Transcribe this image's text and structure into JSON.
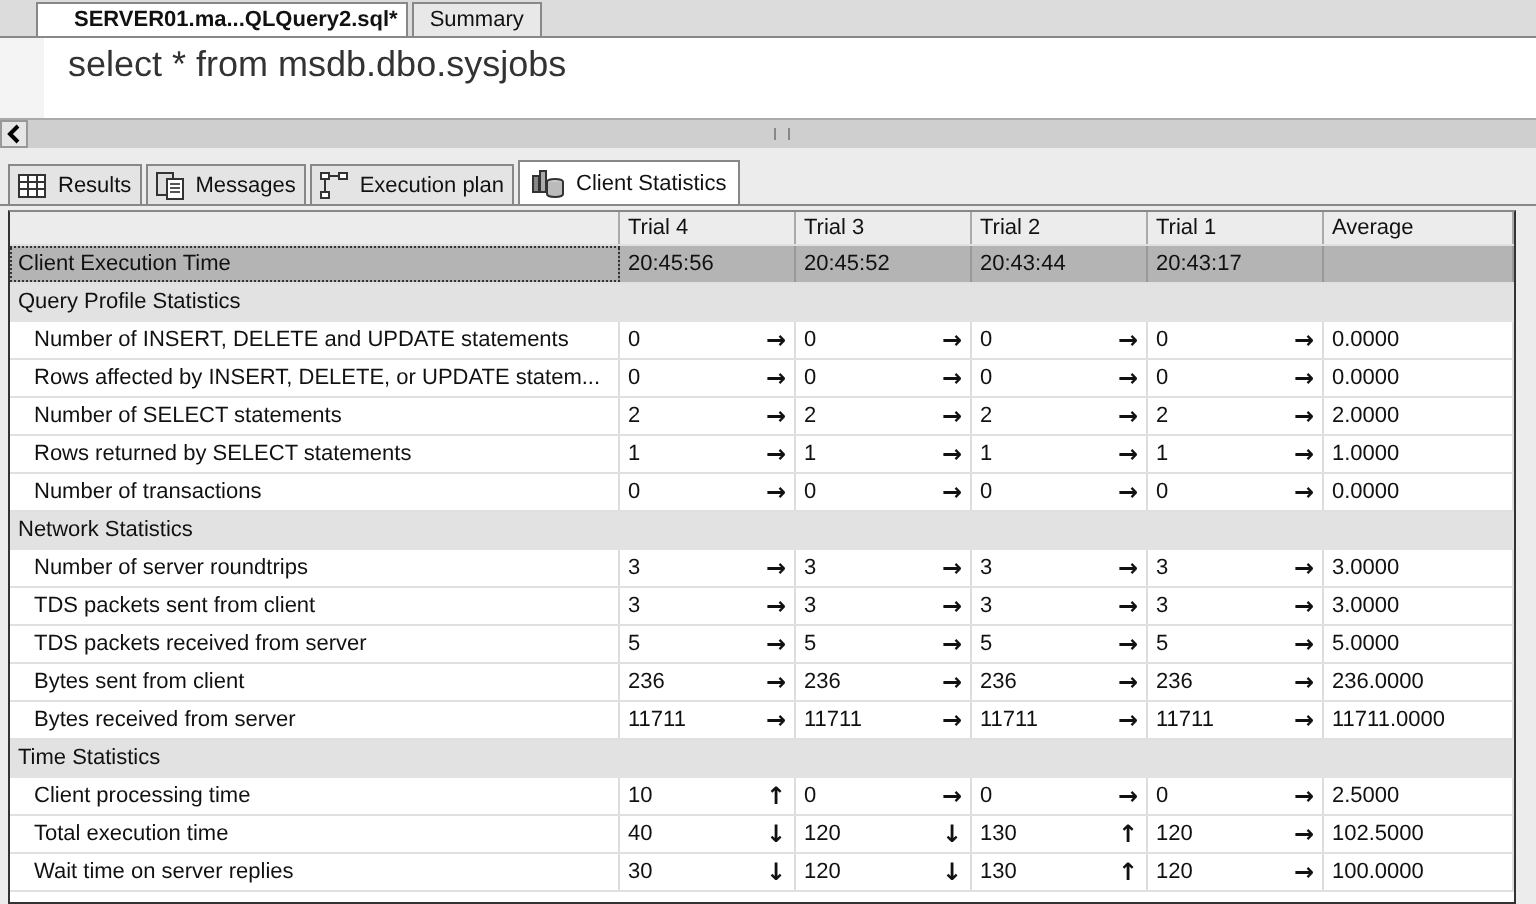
{
  "document_tabs": [
    {
      "label": "SERVER01.ma...QLQuery2.sql*",
      "selected": true
    },
    {
      "label": "Summary",
      "selected": false
    }
  ],
  "editor": {
    "text": "select * from msdb.dbo.sysjobs"
  },
  "result_tabs": [
    {
      "label": "Results",
      "kind": "grid",
      "selected": false
    },
    {
      "label": "Messages",
      "kind": "messages",
      "selected": false
    },
    {
      "label": "Execution plan",
      "kind": "plan",
      "selected": false
    },
    {
      "label": "Client Statistics",
      "kind": "stats",
      "selected": true
    }
  ],
  "grid": {
    "columns": [
      "Trial 4",
      "Trial 3",
      "Trial 2",
      "Trial 1",
      "Average"
    ],
    "execution_row": {
      "label": "Client Execution Time",
      "values": [
        "20:45:56",
        "20:45:52",
        "20:43:44",
        "20:43:17"
      ]
    },
    "sections": [
      {
        "title": "Query Profile Statistics",
        "rows": [
          {
            "label": "Number of INSERT, DELETE and UPDATE statements",
            "values": [
              {
                "text": "0",
                "arrow": "→"
              },
              {
                "text": "0",
                "arrow": "→"
              },
              {
                "text": "0",
                "arrow": "→"
              },
              {
                "text": "0",
                "arrow": "→"
              }
            ],
            "average": "0.0000"
          },
          {
            "label": "Rows affected by INSERT, DELETE, or UPDATE statem...",
            "values": [
              {
                "text": "0",
                "arrow": "→"
              },
              {
                "text": "0",
                "arrow": "→"
              },
              {
                "text": "0",
                "arrow": "→"
              },
              {
                "text": "0",
                "arrow": "→"
              }
            ],
            "average": "0.0000"
          },
          {
            "label": "Number of SELECT statements",
            "values": [
              {
                "text": "2",
                "arrow": "→"
              },
              {
                "text": "2",
                "arrow": "→"
              },
              {
                "text": "2",
                "arrow": "→"
              },
              {
                "text": "2",
                "arrow": "→"
              }
            ],
            "average": "2.0000"
          },
          {
            "label": "Rows returned by SELECT statements",
            "values": [
              {
                "text": "1",
                "arrow": "→"
              },
              {
                "text": "1",
                "arrow": "→"
              },
              {
                "text": "1",
                "arrow": "→"
              },
              {
                "text": "1",
                "arrow": "→"
              }
            ],
            "average": "1.0000"
          },
          {
            "label": "Number of transactions",
            "values": [
              {
                "text": "0",
                "arrow": "→"
              },
              {
                "text": "0",
                "arrow": "→"
              },
              {
                "text": "0",
                "arrow": "→"
              },
              {
                "text": "0",
                "arrow": "→"
              }
            ],
            "average": "0.0000"
          }
        ]
      },
      {
        "title": "Network Statistics",
        "rows": [
          {
            "label": "Number of server roundtrips",
            "values": [
              {
                "text": "3",
                "arrow": "→"
              },
              {
                "text": "3",
                "arrow": "→"
              },
              {
                "text": "3",
                "arrow": "→"
              },
              {
                "text": "3",
                "arrow": "→"
              }
            ],
            "average": "3.0000"
          },
          {
            "label": "TDS packets sent from client",
            "values": [
              {
                "text": "3",
                "arrow": "→"
              },
              {
                "text": "3",
                "arrow": "→"
              },
              {
                "text": "3",
                "arrow": "→"
              },
              {
                "text": "3",
                "arrow": "→"
              }
            ],
            "average": "3.0000"
          },
          {
            "label": "TDS packets received from server",
            "values": [
              {
                "text": "5",
                "arrow": "→"
              },
              {
                "text": "5",
                "arrow": "→"
              },
              {
                "text": "5",
                "arrow": "→"
              },
              {
                "text": "5",
                "arrow": "→"
              }
            ],
            "average": "5.0000"
          },
          {
            "label": "Bytes sent from client",
            "values": [
              {
                "text": "236",
                "arrow": "→"
              },
              {
                "text": "236",
                "arrow": "→"
              },
              {
                "text": "236",
                "arrow": "→"
              },
              {
                "text": "236",
                "arrow": "→"
              }
            ],
            "average": "236.0000"
          },
          {
            "label": "Bytes received from server",
            "values": [
              {
                "text": "11711",
                "arrow": "→"
              },
              {
                "text": "11711",
                "arrow": "→"
              },
              {
                "text": "11711",
                "arrow": "→"
              },
              {
                "text": "11711",
                "arrow": "→"
              }
            ],
            "average": "11711.0000"
          }
        ]
      },
      {
        "title": "Time Statistics",
        "rows": [
          {
            "label": "Client processing time",
            "values": [
              {
                "text": "10",
                "arrow": "↑"
              },
              {
                "text": "0",
                "arrow": "→"
              },
              {
                "text": "0",
                "arrow": "→"
              },
              {
                "text": "0",
                "arrow": "→"
              }
            ],
            "average": "2.5000"
          },
          {
            "label": "Total execution time",
            "values": [
              {
                "text": "40",
                "arrow": "↓"
              },
              {
                "text": "120",
                "arrow": "↓"
              },
              {
                "text": "130",
                "arrow": "↑"
              },
              {
                "text": "120",
                "arrow": "→"
              }
            ],
            "average": "102.5000"
          },
          {
            "label": "Wait time on server replies",
            "values": [
              {
                "text": "30",
                "arrow": "↓"
              },
              {
                "text": "120",
                "arrow": "↓"
              },
              {
                "text": "130",
                "arrow": "↑"
              },
              {
                "text": "120",
                "arrow": "→"
              }
            ],
            "average": "100.0000"
          }
        ]
      }
    ]
  }
}
